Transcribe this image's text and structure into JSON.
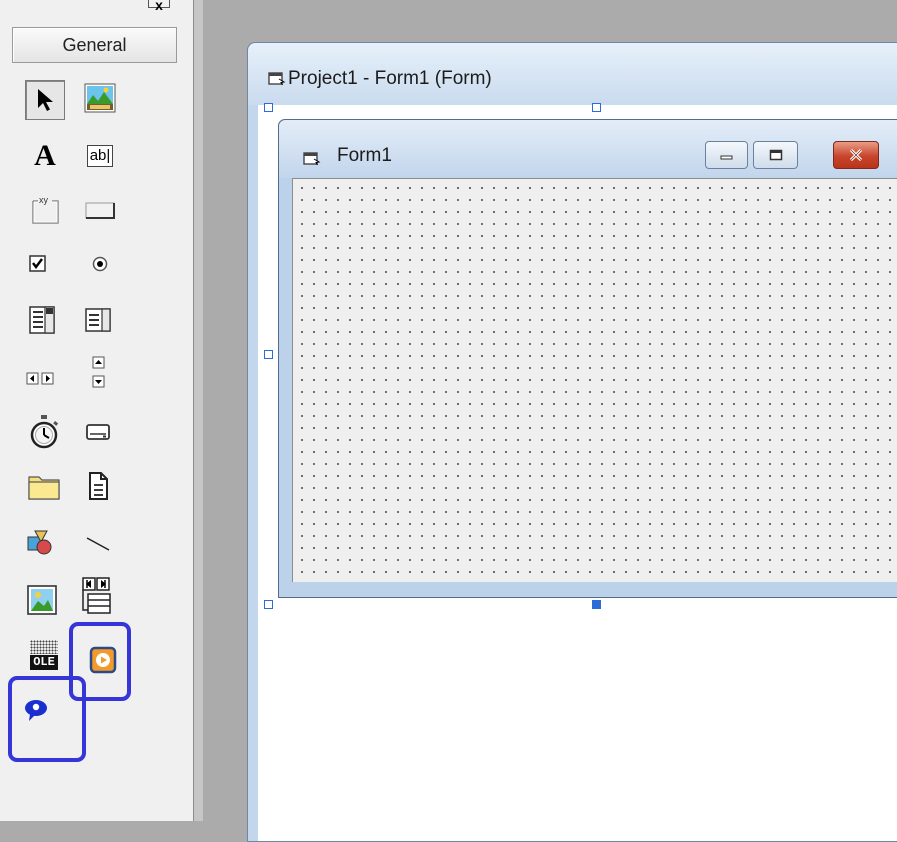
{
  "toolbox": {
    "close_glyph": "x",
    "tab_label": "General",
    "tools": [
      {
        "icon": "pointer-icon"
      },
      {
        "icon": "picturebox-icon"
      },
      {
        "icon": "label-icon",
        "glyph": "A"
      },
      {
        "icon": "textbox-icon",
        "glyph": "ab|"
      },
      {
        "icon": "frame-icon",
        "glyph": "xy"
      },
      {
        "icon": "commandbutton-icon"
      },
      {
        "icon": "checkbox-icon"
      },
      {
        "icon": "optionbutton-icon"
      },
      {
        "icon": "combobox-icon"
      },
      {
        "icon": "listbox-icon"
      },
      {
        "icon": "hscrollbar-icon"
      },
      {
        "icon": "vscrollbar-icon"
      },
      {
        "icon": "timer-icon"
      },
      {
        "icon": "drivelistbox-icon"
      },
      {
        "icon": "dirlistbox-icon"
      },
      {
        "icon": "filelistbox-icon"
      },
      {
        "icon": "shape-icon"
      },
      {
        "icon": "line-icon"
      },
      {
        "icon": "image-icon"
      },
      {
        "icon": "data-icon"
      },
      {
        "icon": "ole-icon",
        "glyph": "OLE"
      },
      {
        "icon": "mediaplayer-icon"
      },
      {
        "icon": "agent-icon"
      }
    ]
  },
  "designer": {
    "title": "Project1 - Form1 (Form)"
  },
  "form": {
    "title": "Form1"
  },
  "colors": {
    "highlight": "#3535d8",
    "selection_handle": "#2d6bd6",
    "close_button": "#c8452d"
  }
}
